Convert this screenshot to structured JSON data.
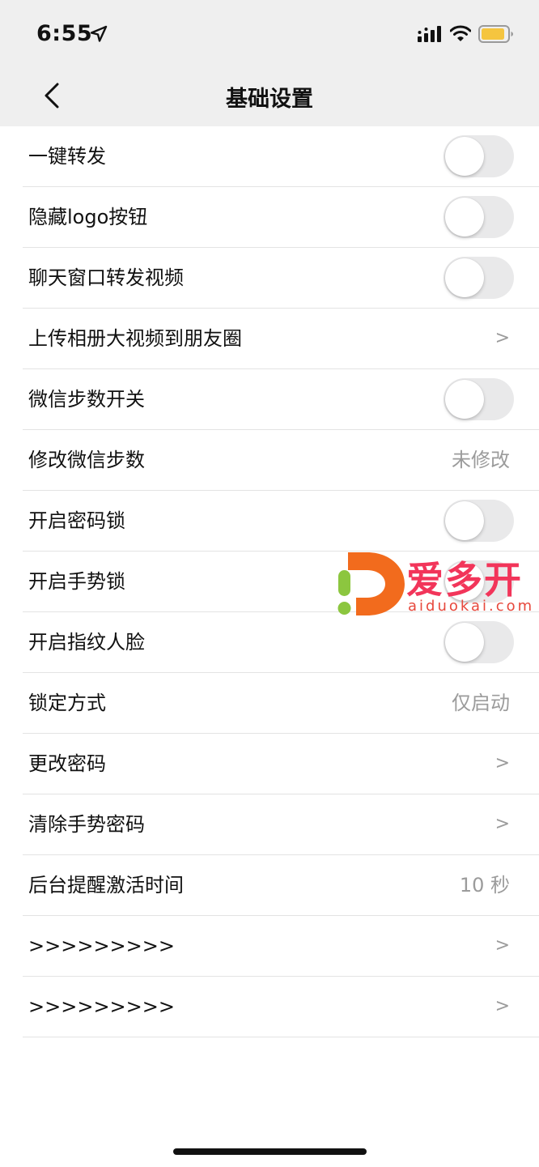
{
  "status_bar": {
    "time": "6:55",
    "icons": [
      "location-arrow-icon",
      "cellular-signal-icon",
      "wifi-icon",
      "battery-icon"
    ],
    "battery_color": "#f5c53f"
  },
  "nav": {
    "title": "基础设置",
    "back_icon": "chevron-left-icon"
  },
  "settings": {
    "rows": [
      {
        "label": "一键转发",
        "type": "toggle",
        "on": false
      },
      {
        "label": "隐藏logo按钮",
        "type": "toggle",
        "on": false
      },
      {
        "label": "聊天窗口转发视频",
        "type": "toggle",
        "on": false
      },
      {
        "label": "上传相册大视频到朋友圈",
        "type": "arrow",
        "arrow": ">"
      },
      {
        "label": "微信步数开关",
        "type": "toggle",
        "on": false
      },
      {
        "label": "修改微信步数",
        "type": "value",
        "value": "未修改"
      },
      {
        "label": "开启密码锁",
        "type": "toggle",
        "on": false
      },
      {
        "label": "开启手势锁",
        "type": "toggle",
        "on": false
      },
      {
        "label": "开启指纹人脸",
        "type": "toggle",
        "on": false
      },
      {
        "label": "锁定方式",
        "type": "value",
        "value": "仅启动"
      },
      {
        "label": "更改密码",
        "type": "arrow",
        "arrow": ">"
      },
      {
        "label": "清除手势密码",
        "type": "arrow",
        "arrow": ">"
      },
      {
        "label": "后台提醒激活时间",
        "type": "value",
        "value": "10 秒"
      },
      {
        "label": ">>>>>>>>>",
        "type": "arrow",
        "arrow": ">"
      },
      {
        "label": ">>>>>>>>>",
        "type": "arrow",
        "arrow": ">"
      }
    ]
  },
  "watermark": {
    "title": "爱多开",
    "subtitle": "aiduokai.com",
    "colors": {
      "orange": "#f26b1d",
      "green": "#8cc63f",
      "red": "#f2355a"
    }
  },
  "colors": {
    "header_bg": "#efefef",
    "toggle_off_bg": "#e9e9ea",
    "secondary_text": "#9b9b9b",
    "divider": "#e3e3e3"
  }
}
